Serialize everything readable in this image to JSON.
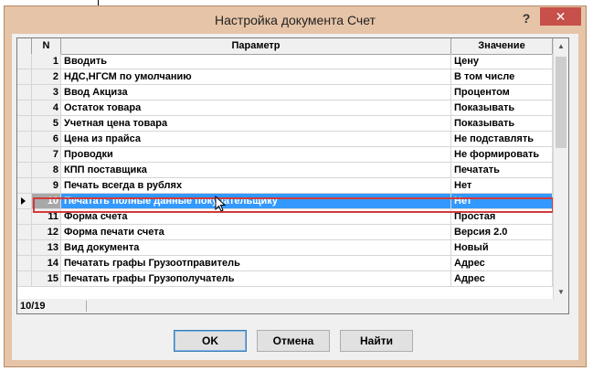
{
  "window": {
    "title": "Настройка документа Счет",
    "help_label": "?",
    "close_label": "✕"
  },
  "table": {
    "columns": {
      "n": "N",
      "param": "Параметр",
      "value": "Значение"
    },
    "rows": [
      {
        "n": "1",
        "param": "Вводить",
        "value": "Цену"
      },
      {
        "n": "2",
        "param": "НДС,НГСМ по умолчанию",
        "value": "В том числе"
      },
      {
        "n": "3",
        "param": "Ввод Акциза",
        "value": "Процентом"
      },
      {
        "n": "4",
        "param": "Остаток товара",
        "value": "Показывать"
      },
      {
        "n": "5",
        "param": "Учетная цена товара",
        "value": "Показывать"
      },
      {
        "n": "6",
        "param": "Цена из прайса",
        "value": "Не подставлять"
      },
      {
        "n": "7",
        "param": "Проводки",
        "value": "Не формировать"
      },
      {
        "n": "8",
        "param": "КПП поставщика",
        "value": "Печатать"
      },
      {
        "n": "9",
        "param": "Печать всегда в рублях",
        "value": "Нет"
      },
      {
        "n": "10",
        "param": "Печатать полные данные покупательщику",
        "value": "Нет"
      },
      {
        "n": "11",
        "param": "Форма счета",
        "value": "Простая"
      },
      {
        "n": "12",
        "param": "Форма печати счета",
        "value": "Версия 2.0"
      },
      {
        "n": "13",
        "param": "Вид документа",
        "value": "Новый"
      },
      {
        "n": "14",
        "param": "Печатать графы Грузоотправитель",
        "value": "Адрес"
      },
      {
        "n": "15",
        "param": "Печатать графы Грузополучатель",
        "value": "Адрес"
      }
    ],
    "selected_index": 9
  },
  "status": {
    "position": "10/19"
  },
  "buttons": {
    "ok": "OK",
    "cancel": "Отмена",
    "find": "Найти"
  },
  "colors": {
    "title_bg": "#e6c4a7",
    "selection": "#3399ff",
    "close": "#c7504b",
    "highlight_border": "#d23a3a"
  }
}
